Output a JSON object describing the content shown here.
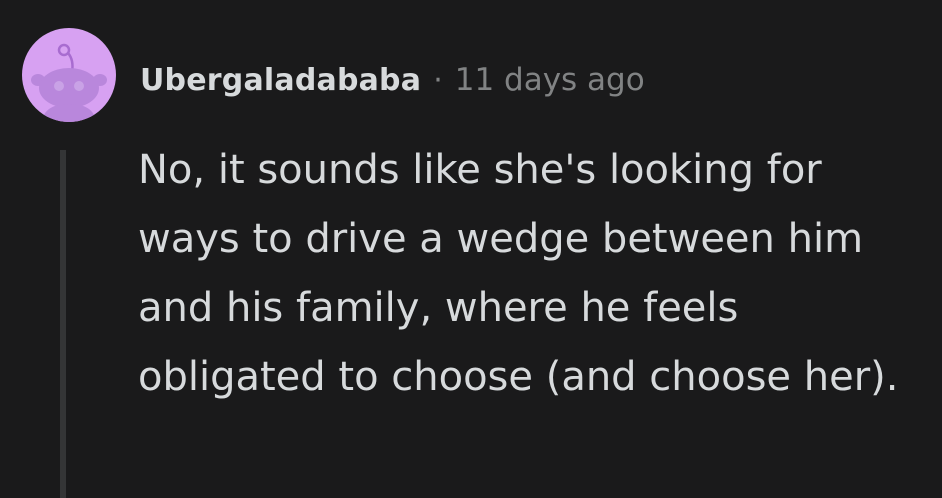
{
  "comment": {
    "author": "Ubergaladababa",
    "separator": "·",
    "time": "11 days ago",
    "body": "No, it sounds like she's looking for ways to drive a wedge between him and his family, where he feels obligated to choose (and choose her)."
  },
  "avatar": {
    "icon": "snoo-avatar-icon",
    "background_color": "#d7a1f2",
    "figure_color": "#a86cd0"
  },
  "colors": {
    "background": "#1a1a1b",
    "text": "#d7dadc",
    "meta_text": "#818384",
    "thread_line": "#343536"
  }
}
